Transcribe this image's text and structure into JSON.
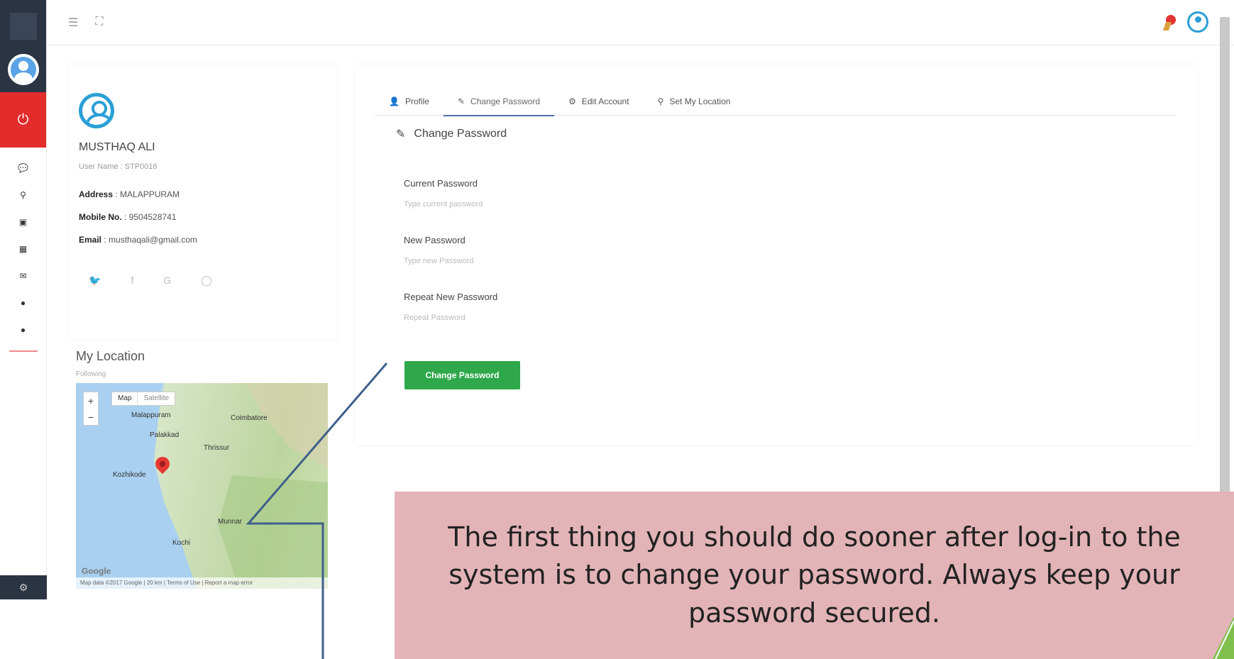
{
  "rail": {
    "icons": [
      "chat-icon",
      "pin-icon",
      "image-icon",
      "grid-icon",
      "comments-icon",
      "pin-icon",
      "pin-icon"
    ],
    "power_icon": "power-icon",
    "settings_icon": "gear-icon"
  },
  "topbar": {
    "menu_icon": "menu-icon",
    "fullscreen_icon": "fullscreen-icon"
  },
  "profile": {
    "name": "MUSTHAQ ALI",
    "username": "User Name : STP0016",
    "address_label": "Address",
    "address_value": " : MALAPPURAM",
    "mobile_label": "Mobile No.",
    "mobile_value": " : 9504528741",
    "email_label": "Email",
    "email_value": " : musthaqali@gmail.com"
  },
  "location": {
    "title": "My Location",
    "subtitle": "Following",
    "map_type_map": "Map",
    "map_type_satellite": "Satellite",
    "labels": {
      "malappuram": "Malappuram",
      "coimbatore": "Coimbatore",
      "palakkad": "Palakkad",
      "thrissur": "Thrissur",
      "kozhikode": "Kozhikode",
      "munnar": "Munnar",
      "kochi": "Kochi"
    },
    "google": "Google",
    "footer": "Map data ©2017 Google | 20 km | Terms of Use | Report a map error"
  },
  "tabs": [
    {
      "icon": "user-icon",
      "label": "Profile"
    },
    {
      "icon": "pencil-icon",
      "label": "Change Password"
    },
    {
      "icon": "gear-icon",
      "label": "Edit Account"
    },
    {
      "icon": "pin-icon",
      "label": "Set My Location"
    }
  ],
  "form": {
    "title": "Change Password",
    "current_label": "Current Password",
    "current_placeholder": "Type current password",
    "new_label": "New Password",
    "new_placeholder": "Type new Password",
    "repeat_label": "Repeat New Password",
    "repeat_placeholder": "Repeat Password",
    "submit_label": "Change Password"
  },
  "callout": {
    "text": "The first thing you should do sooner after log-in to the system is to change your password. Always keep your password secured."
  }
}
